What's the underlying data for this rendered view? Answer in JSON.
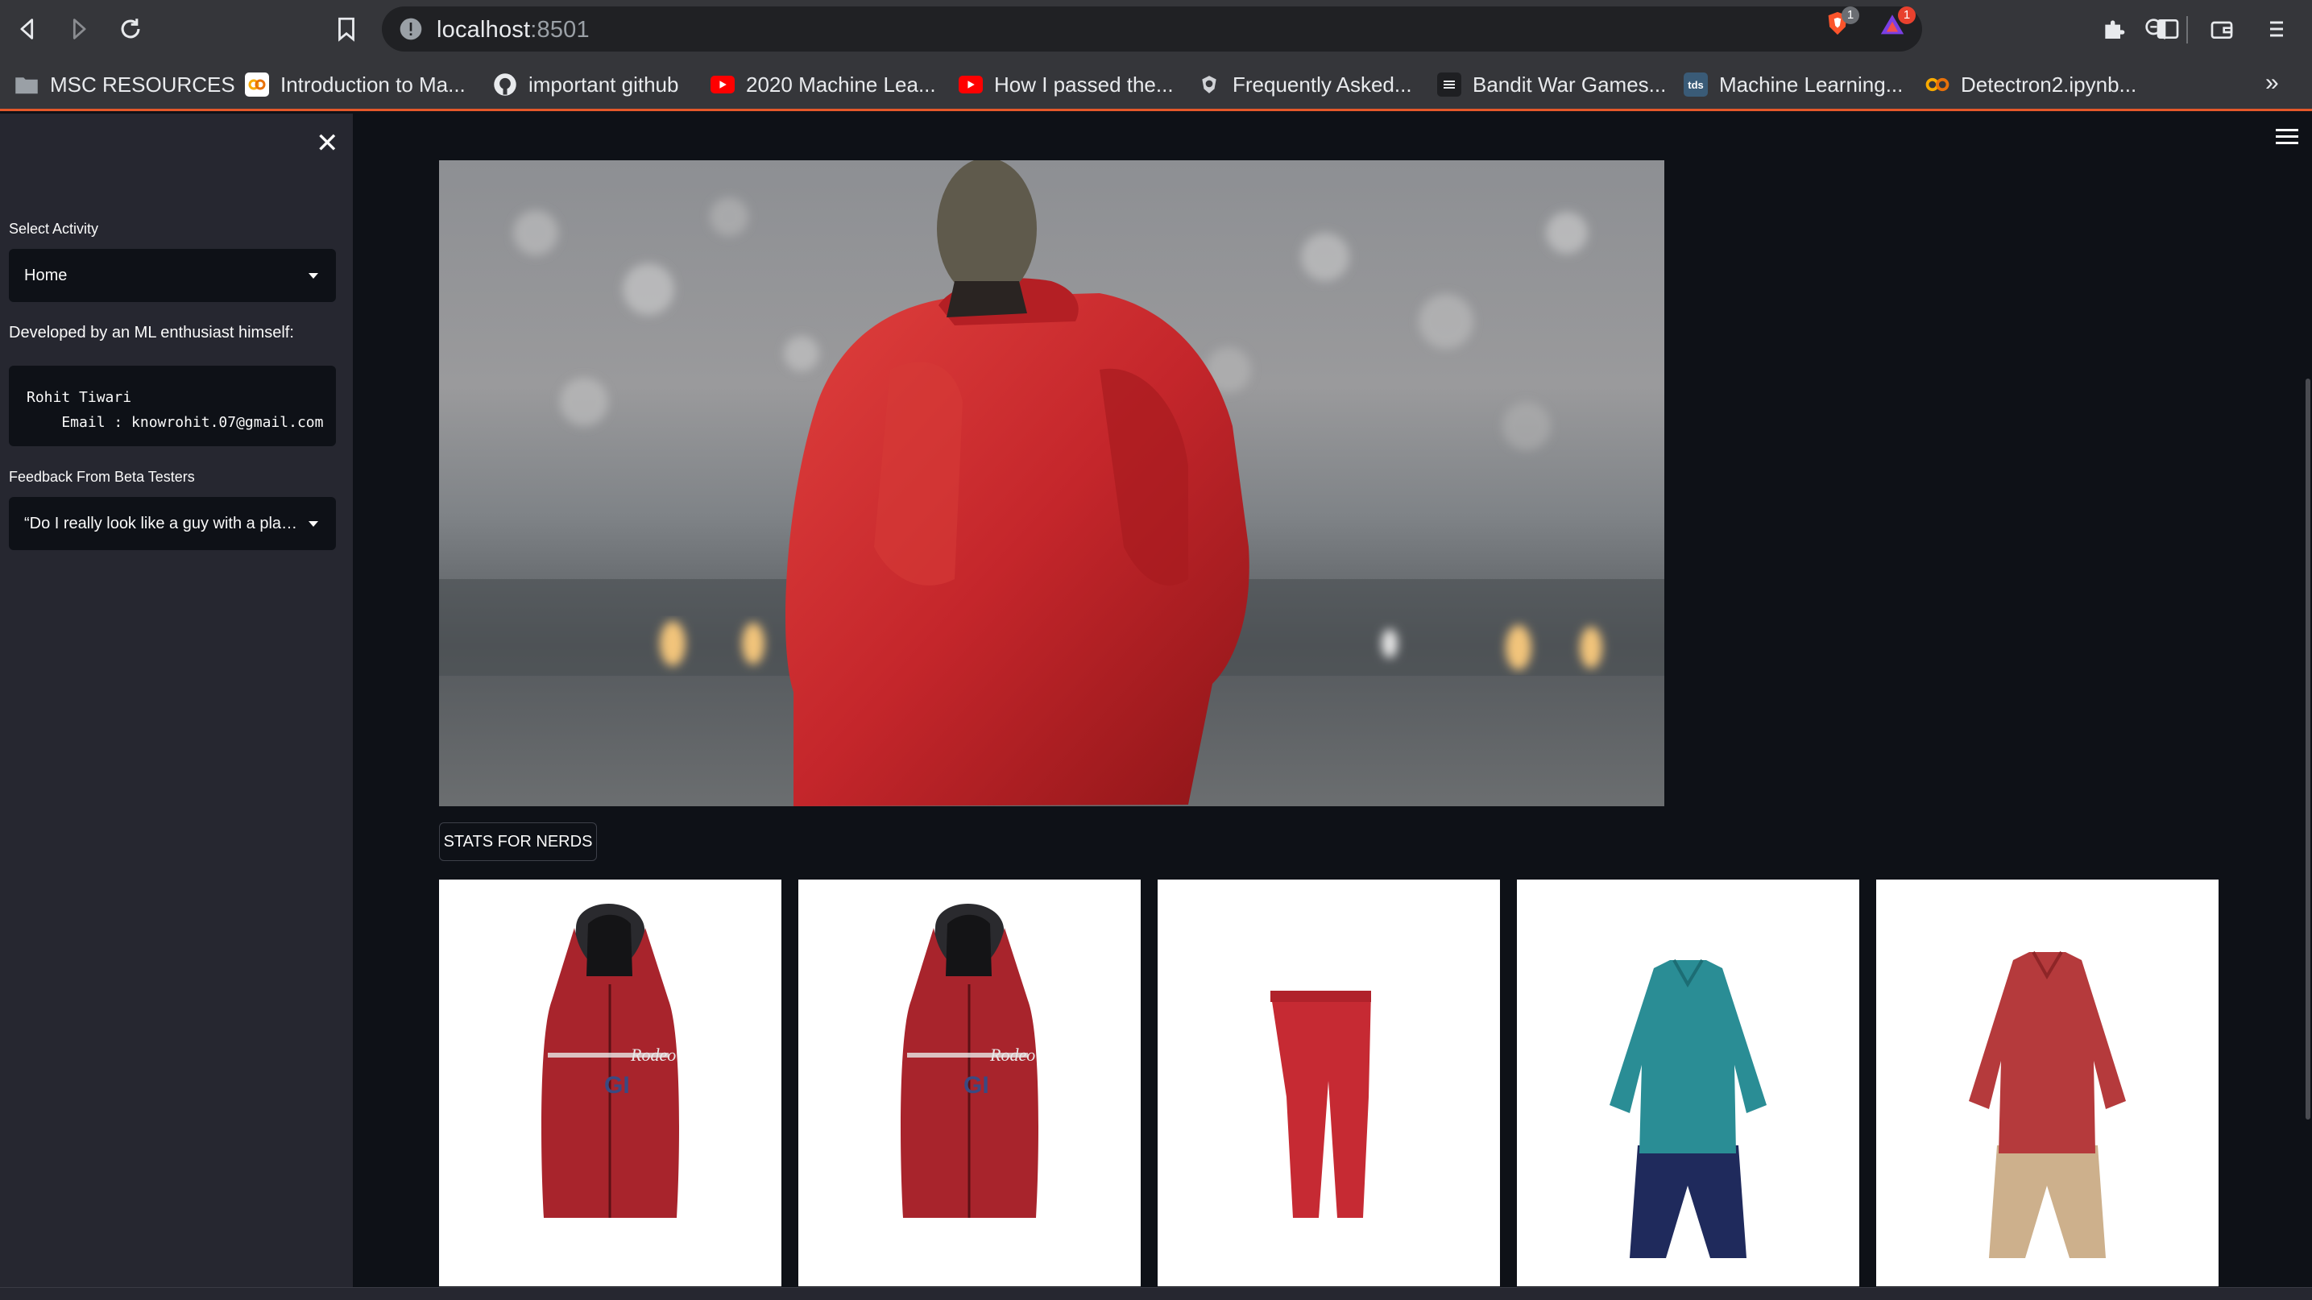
{
  "browser": {
    "url_host": "localhost",
    "url_port": ":8501",
    "shield_count": "1",
    "rewards_count": "1",
    "bookmarks": [
      {
        "label": "MSC RESOURCES",
        "icon": "folder-icon"
      },
      {
        "label": "Introduction to Ma...",
        "icon": "colab-icon"
      },
      {
        "label": "important github",
        "icon": "github-icon"
      },
      {
        "label": "2020 Machine Lea...",
        "icon": "youtube-icon"
      },
      {
        "label": "How I passed the...",
        "icon": "youtube-icon"
      },
      {
        "label": "Frequently Asked...",
        "icon": "shield-icon"
      },
      {
        "label": "Bandit War Games...",
        "icon": "doc-icon"
      },
      {
        "label": "Machine Learning...",
        "icon": "tds-icon"
      },
      {
        "label": "Detectron2.ipynb...",
        "icon": "colab-icon"
      }
    ],
    "tds_text": "tds"
  },
  "sidebar": {
    "close_glyph": "✕",
    "select_activity_label": "Select Activity",
    "select_activity_value": "Home",
    "developer_label": "Developed by an ML enthusiast himself:",
    "developer_code": "Rohit Tiwari\n    Email : knowrohit.07@gmail.com",
    "feedback_label": "Feedback From Beta Testers",
    "feedback_value": "“Do I really look like a guy with a plan? You know what I am? I'm a dog chasing cars.”"
  },
  "main": {
    "stats_button": "STATS FOR NERDS",
    "hero_description": "Figure in red puffer jacket and mask in a stadium",
    "products": [
      "red-hooded-vest",
      "red-hooded-vest",
      "red-leggings",
      "teal-kurta-dhoti",
      "red-kurta-dhoti"
    ]
  },
  "colors": {
    "app_bg": "#0e1117",
    "sidebar_bg": "#262730",
    "chrome_bg": "#35363a",
    "accent_line": "#e4582a",
    "jacket_red": "#c4262b"
  }
}
